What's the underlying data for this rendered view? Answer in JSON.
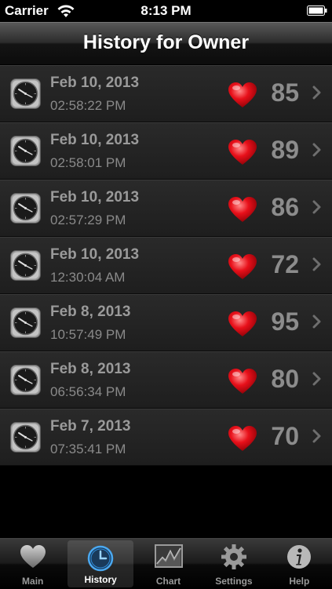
{
  "status_bar": {
    "carrier": "Carrier",
    "time": "8:13 PM"
  },
  "nav": {
    "title": "History for Owner"
  },
  "history": [
    {
      "date": "Feb 10, 2013",
      "time": "02:58:22 PM",
      "bpm": "85"
    },
    {
      "date": "Feb 10, 2013",
      "time": "02:58:01 PM",
      "bpm": "89"
    },
    {
      "date": "Feb 10, 2013",
      "time": "02:57:29 PM",
      "bpm": "86"
    },
    {
      "date": "Feb 10, 2013",
      "time": "12:30:04 AM",
      "bpm": "72"
    },
    {
      "date": "Feb 8, 2013",
      "time": "10:57:49 PM",
      "bpm": "95"
    },
    {
      "date": "Feb 8, 2013",
      "time": "06:56:34 PM",
      "bpm": "80"
    },
    {
      "date": "Feb 7, 2013",
      "time": "07:35:41 PM",
      "bpm": "70"
    }
  ],
  "tabs": [
    {
      "label": "Main",
      "icon": "heart-icon"
    },
    {
      "label": "History",
      "icon": "clock-icon",
      "selected": true
    },
    {
      "label": "Chart",
      "icon": "chart-icon"
    },
    {
      "label": "Settings",
      "icon": "gear-icon"
    },
    {
      "label": "Help",
      "icon": "info-icon"
    }
  ],
  "colors": {
    "heart": "#e8101a",
    "selected_tab_accent": "#2f8bd8"
  }
}
